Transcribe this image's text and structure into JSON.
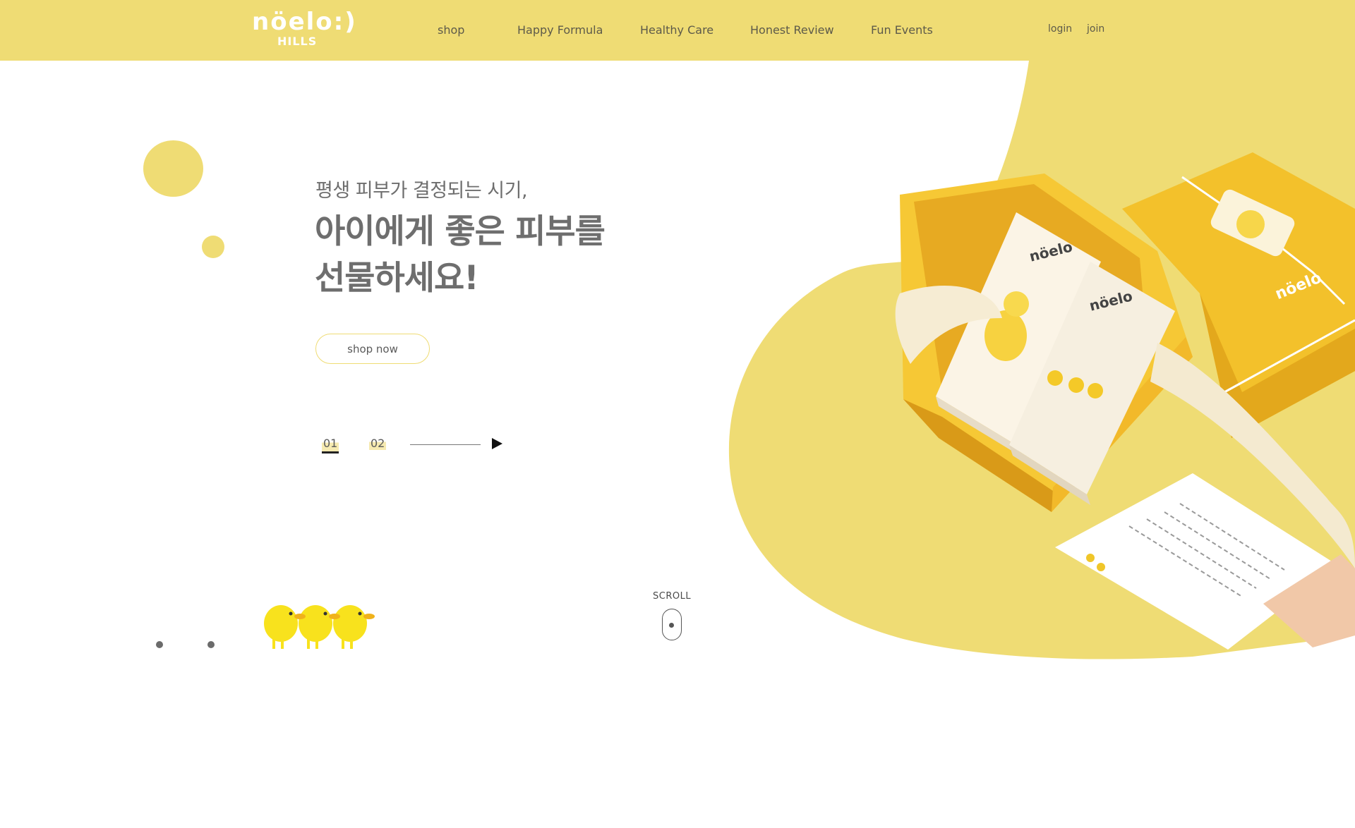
{
  "brand": {
    "logo_main": "nöelo:)",
    "logo_sub": "HILLS"
  },
  "nav": {
    "items": [
      {
        "label": "shop"
      },
      {
        "label": "Happy Formula"
      },
      {
        "label": "Healthy Care"
      },
      {
        "label": "Honest Review"
      },
      {
        "label": "Fun Events"
      }
    ]
  },
  "util": {
    "login": "login",
    "join": "join"
  },
  "hero": {
    "subtitle": "평생 피부가 결정되는 시기,",
    "title_line1": "아이에게 좋은 피부를",
    "title_line2": "선물하세요!",
    "cta_label": "shop now",
    "product_image_icon": "gift-box-product-image"
  },
  "slider": {
    "slides": [
      {
        "label": "01",
        "active": true
      },
      {
        "label": "02",
        "active": false
      }
    ],
    "play_icon": "play-icon"
  },
  "scroll": {
    "label": "SCROLL",
    "icon": "mouse-scroll-icon"
  },
  "colors": {
    "accent_yellow": "#efdc74",
    "chick_yellow": "#f8e21d",
    "text_gray": "#6e6e6e",
    "dot_gray": "#6b6b6b"
  }
}
